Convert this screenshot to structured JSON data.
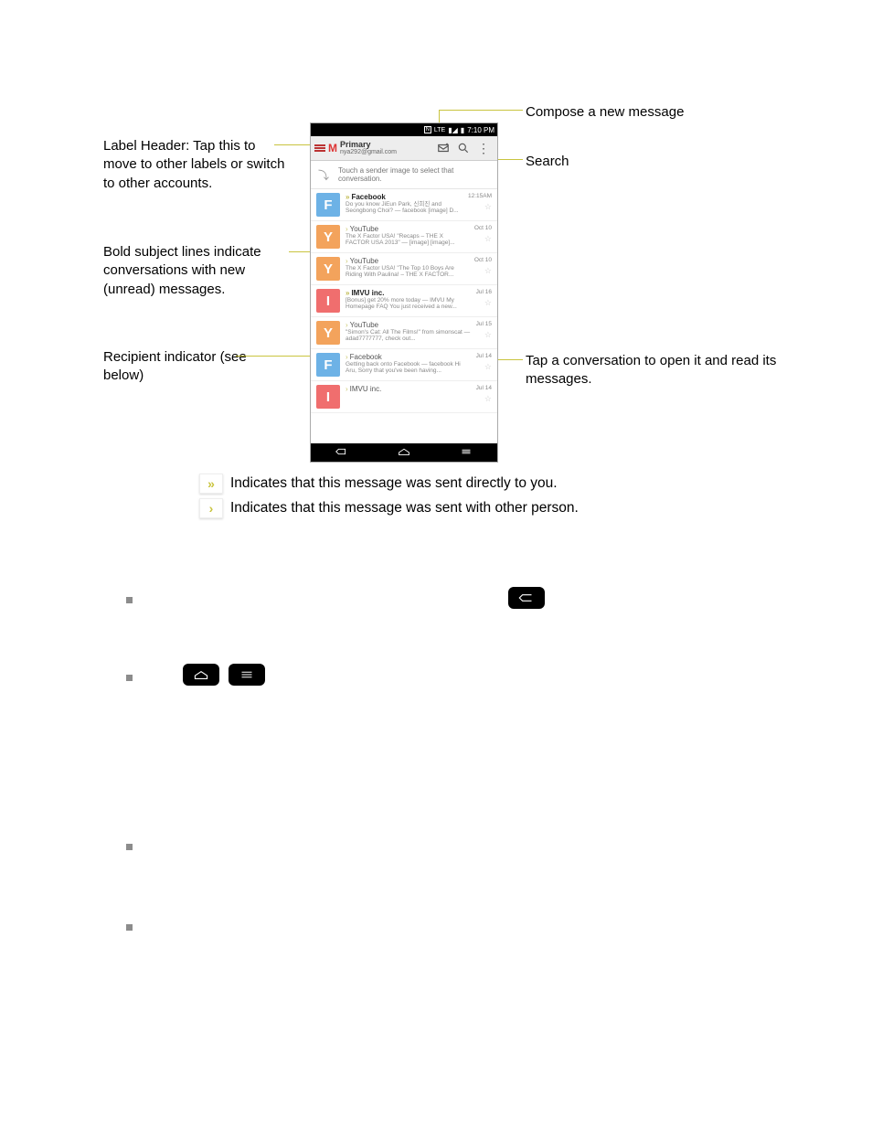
{
  "annotations": {
    "compose": "Compose a new message",
    "search": "Search",
    "label_header": "Label Header: Tap this to move to other labels or switch to other accounts.",
    "bold_subject": "Bold subject lines indicate conversations with new (unread) messages.",
    "recipient": "Recipient indicator (see below)",
    "tap_conv": "Tap a conversation to open it and read its messages."
  },
  "phone": {
    "status_time": "7:10 PM",
    "status_net": "LTE",
    "header": {
      "primary": "Primary",
      "account": "nya292@gmail.com"
    },
    "hint": "Touch a sender image to select that conversation.",
    "messages": [
      {
        "avatar": "F",
        "avclass": "avF",
        "sender": "Facebook",
        "bold": true,
        "date": "12:15AM",
        "snippet": "Do you know JiEun Park, 신희진 and Seongbong Choi? — facebook [image] D..."
      },
      {
        "avatar": "Y",
        "avclass": "avY",
        "sender": "YouTube",
        "bold": false,
        "date": "Oct 10",
        "snippet": "The X Factor USA! \"Recaps – THE X FACTOR USA 2013\" — [image] [image]..."
      },
      {
        "avatar": "Y",
        "avclass": "avY",
        "sender": "YouTube",
        "bold": false,
        "date": "Oct 10",
        "snippet": "The X Factor USA! \"The Top 10 Boys Are Riding With Paulina! – THE X FACTOR..."
      },
      {
        "avatar": "I",
        "avclass": "avI",
        "sender": "IMVU inc.",
        "bold": true,
        "date": "Jul 16",
        "snippet": "[Bonus] get 20% more today — IMVU My Homepage FAQ You just received a new..."
      },
      {
        "avatar": "Y",
        "avclass": "avY",
        "sender": "YouTube",
        "bold": false,
        "date": "Jul 15",
        "snippet": "\"Simon's Cat: All The Films!\" from simonscat — adad7777777, check out..."
      },
      {
        "avatar": "F",
        "avclass": "avF",
        "sender": "Facebook",
        "bold": false,
        "date": "Jul 14",
        "snippet": "Getting back onto Facebook — facebook Hi Aru, Sorry that you've been having..."
      },
      {
        "avatar": "I",
        "avclass": "avI",
        "sender": "IMVU inc.",
        "bold": false,
        "date": "Jul 14",
        "snippet": ""
      }
    ]
  },
  "legend": {
    "direct": "Indicates that this message was sent directly to you.",
    "other": "Indicates that this message was sent with other person."
  }
}
